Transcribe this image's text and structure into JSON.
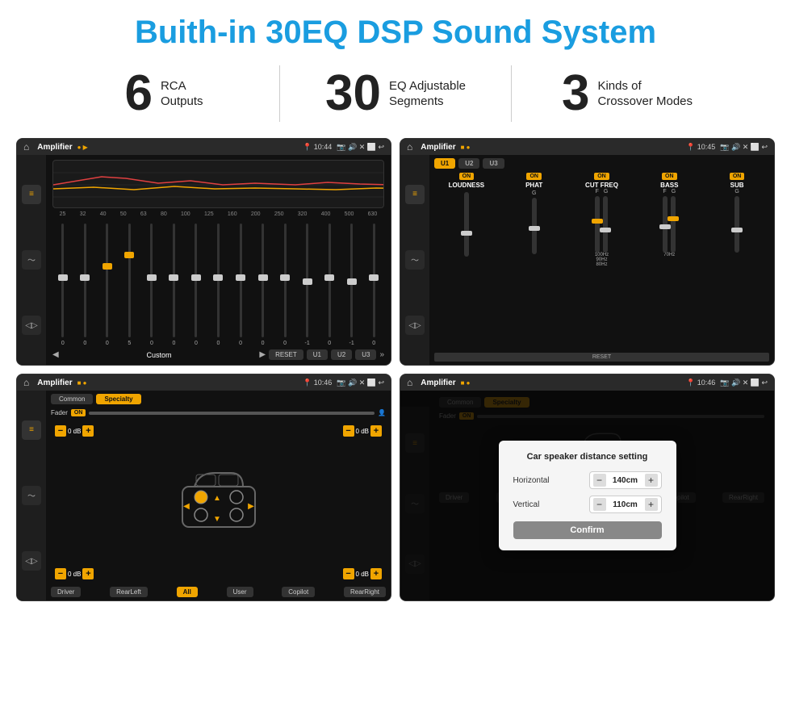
{
  "header": {
    "title": "Buith-in 30EQ DSP Sound System"
  },
  "stats": [
    {
      "number": "6",
      "label_line1": "RCA",
      "label_line2": "Outputs"
    },
    {
      "number": "30",
      "label_line1": "EQ Adjustable",
      "label_line2": "Segments"
    },
    {
      "number": "3",
      "label_line1": "Kinds of",
      "label_line2": "Crossover Modes"
    }
  ],
  "screen1": {
    "topbar": {
      "title": "Amplifier",
      "time": "10:44"
    },
    "eq_labels": [
      "25",
      "32",
      "40",
      "50",
      "63",
      "80",
      "100",
      "125",
      "160",
      "200",
      "250",
      "320",
      "400",
      "500",
      "630"
    ],
    "eq_values": [
      "0",
      "0",
      "0",
      "5",
      "0",
      "0",
      "0",
      "0",
      "0",
      "0",
      "0",
      "-1",
      "0",
      "-1"
    ],
    "preset": "Custom",
    "buttons": [
      "RESET",
      "U1",
      "U2",
      "U3"
    ]
  },
  "screen2": {
    "topbar": {
      "title": "Amplifier",
      "time": "10:45"
    },
    "presets": [
      "U1",
      "U2",
      "U3"
    ],
    "channels": [
      {
        "name": "LOUDNESS",
        "on": true
      },
      {
        "name": "PHAT",
        "on": true
      },
      {
        "name": "CUT FREQ",
        "on": true
      },
      {
        "name": "BASS",
        "on": true
      },
      {
        "name": "SUB",
        "on": true
      }
    ],
    "reset_label": "RESET"
  },
  "screen3": {
    "topbar": {
      "title": "Amplifier",
      "time": "10:46"
    },
    "tabs": [
      "Common",
      "Specialty"
    ],
    "fader_label": "Fader",
    "fader_on": "ON",
    "vol_groups": [
      {
        "pos": "top-left",
        "value": "0 dB"
      },
      {
        "pos": "top-right",
        "value": "0 dB"
      },
      {
        "pos": "bottom-left",
        "value": "0 dB"
      },
      {
        "pos": "bottom-right",
        "value": "0 dB"
      }
    ],
    "bottom_buttons": [
      "Driver",
      "RearLeft",
      "All",
      "User",
      "Copilot",
      "RearRight"
    ]
  },
  "screen4": {
    "topbar": {
      "title": "Amplifier",
      "time": "10:46"
    },
    "dialog": {
      "title": "Car speaker distance setting",
      "horizontal_label": "Horizontal",
      "horizontal_value": "140cm",
      "vertical_label": "Vertical",
      "vertical_value": "110cm",
      "confirm_label": "Confirm"
    }
  }
}
